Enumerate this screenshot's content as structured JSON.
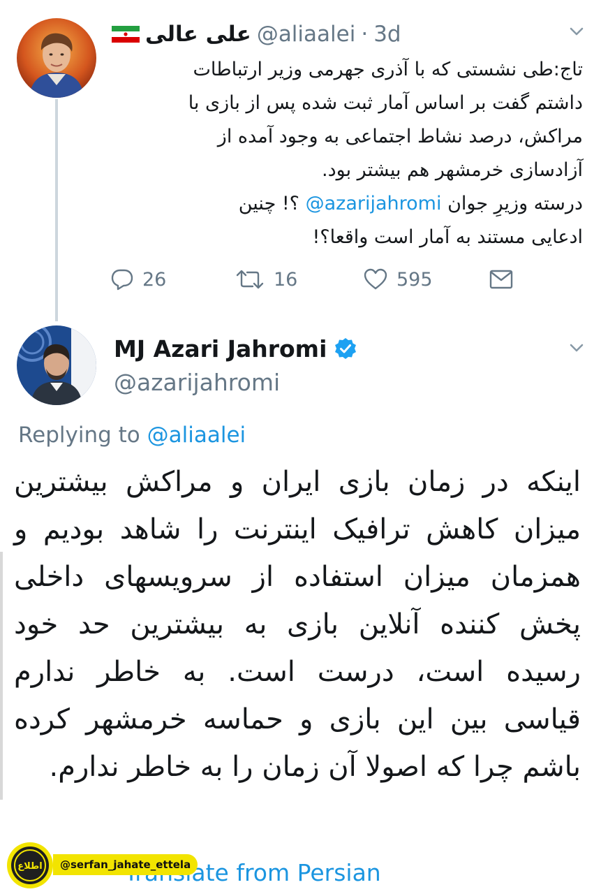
{
  "tweet1": {
    "display_name": "علی عالی",
    "flag": "iran-flag",
    "handle": "@aliaalei",
    "separator": "·",
    "time": "3d",
    "body_lines": [
      "تاج:طی نشستی که با آذری جهرمی وزیر ارتباطات",
      "داشتم گفت بر اساس آمار ثبت شده پس از بازی با",
      "مراکش، درصد نشاط اجتماعی به وجود آمده از",
      "آزادسازی خرمشهر هم بیشتر بود."
    ],
    "body2_prefix": "درسته وزیرِ جوان",
    "body2_mention": "@azarijahromi",
    "body2_suffix": "؟! چنین",
    "body2_line2": "ادعایی مستند به آمار است واقعا؟!",
    "actions": {
      "replies": "26",
      "retweets": "16",
      "likes": "595"
    }
  },
  "tweet2": {
    "display_name": "MJ Azari Jahromi",
    "verified": true,
    "handle": "@azarijahromi",
    "replying_label": "Replying to",
    "replying_to": "@aliaalei",
    "body": "اینکه در زمان بازی ایران و مراکش بیشترین میزان کاهش ترافیک اینترنت را شاهد بودیم و همزمان میزان استفاده از سرویسهای داخلی پخش کننده آنلاین بازی به بیشترین حد خود رسیده است، درست است. به خاطر ندارم قیاسی بین این بازی و حماسه خرمشهر کرده باشم چرا که اصولا آن زمان را به خاطر ندارم.",
    "translate_label": "Translate from Persian"
  },
  "watermark": {
    "handle": "@serfan_jahate_ettela",
    "logo_text": "اطلاع"
  },
  "colors": {
    "link": "#1b95e0",
    "muted": "#657786",
    "text": "#14171a",
    "thread_line": "#cdd6dd"
  }
}
